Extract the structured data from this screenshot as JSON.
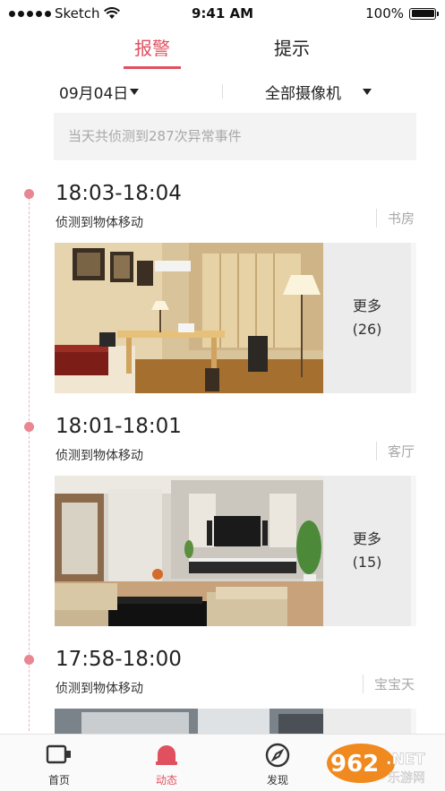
{
  "status_bar": {
    "carrier": "Sketch",
    "time": "9:41 AM",
    "battery": "100%",
    "battery_level": 1.0
  },
  "tabs": [
    {
      "label": "报警",
      "active": true
    },
    {
      "label": "提示",
      "active": false
    }
  ],
  "filters": {
    "date": "09月04日",
    "camera": "全部摄像机"
  },
  "summary": "当天共侦测到287次异常事件",
  "events": [
    {
      "time": "18:03-18:04",
      "description": "侦测到物体移动",
      "room": "书房",
      "more_label": "更多",
      "more_count": "(26)"
    },
    {
      "time": "18:01-18:01",
      "description": "侦测到物体移动",
      "room": "客厅",
      "more_label": "更多",
      "more_count": "(15)"
    },
    {
      "time": "17:58-18:00",
      "description": "侦测到物体移动",
      "room": "宝宝天"
    }
  ],
  "bottom_nav": [
    {
      "label": "首页",
      "icon": "camera-icon",
      "active": false
    },
    {
      "label": "动态",
      "icon": "bell-icon",
      "active": true
    },
    {
      "label": "发现",
      "icon": "compass-icon",
      "active": false
    }
  ],
  "watermark": {
    "text": "962.NET",
    "subtext": "乐游网"
  },
  "colors": {
    "accent": "#e0505f",
    "timeline_dot": "#e88791",
    "muted_text": "#a8a8a8",
    "panel_bg": "#f3f3f3"
  }
}
